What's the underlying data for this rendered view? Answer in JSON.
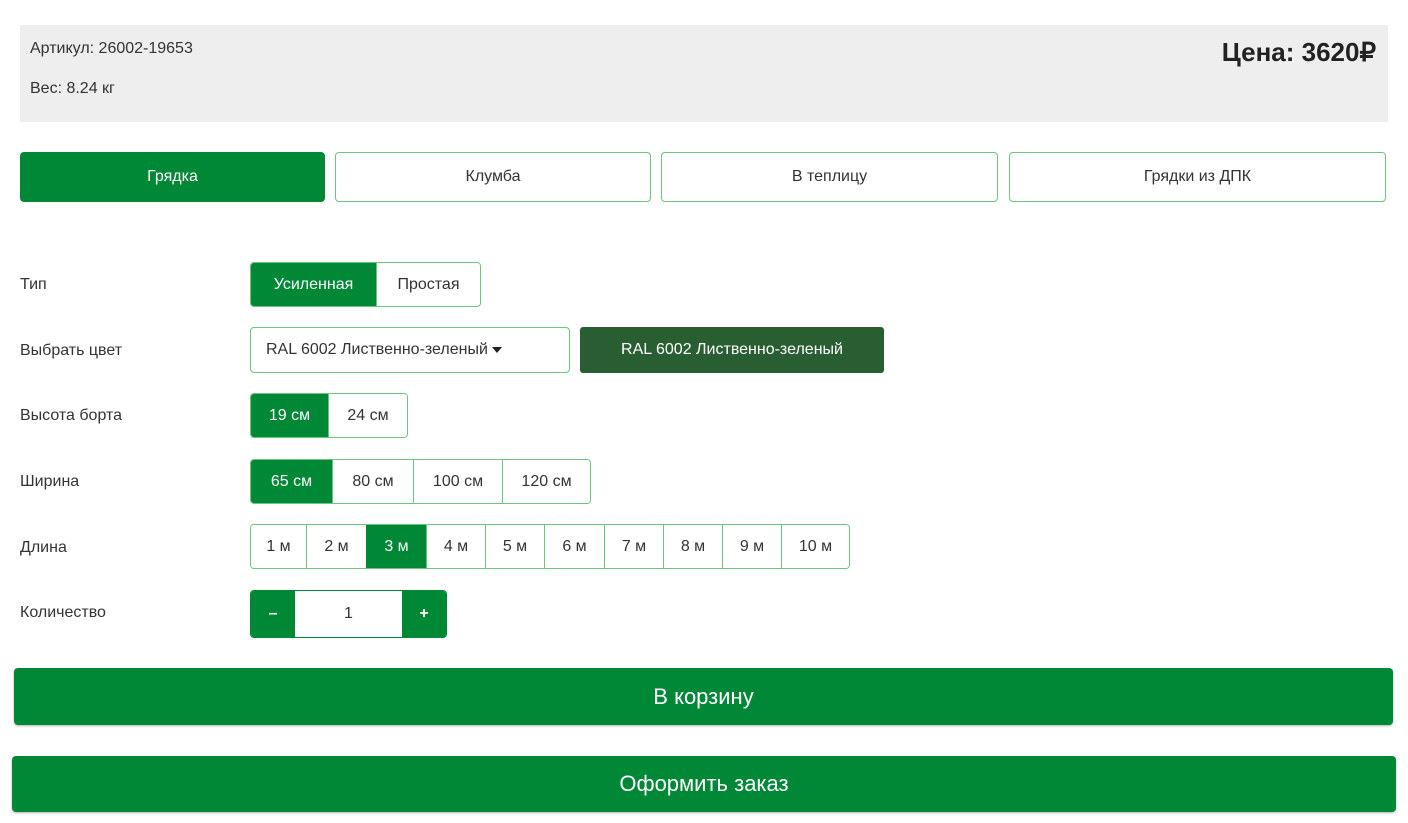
{
  "info": {
    "sku": "Артикул: 26002-19653",
    "weight": "Вес: 8.24 кг",
    "price": "Цена: 3620₽"
  },
  "tabs": [
    {
      "label": "Грядка",
      "active": true
    },
    {
      "label": "Клумба"
    },
    {
      "label": "В теплицу"
    },
    {
      "label": "Грядки из ДПК"
    }
  ],
  "type": {
    "label": "Тип",
    "options": [
      "Усиленная",
      "Простая"
    ],
    "selected": "Усиленная"
  },
  "color": {
    "label": "Выбрать цвет",
    "value": "RAL 6002 Лиственно-зеленый",
    "swatch_label": "RAL 6002 Лиственно-зеленый",
    "swatch_color": "#285e32"
  },
  "height": {
    "label": "Высота борта",
    "options": [
      "19 см",
      "24 см"
    ],
    "selected": "19 см"
  },
  "width": {
    "label": "Ширина",
    "options": [
      "65 см",
      "80 см",
      "100 см",
      "120 см"
    ],
    "selected": "65 см"
  },
  "length": {
    "label": "Длина",
    "options": [
      "1 м",
      "2 м",
      "3 м",
      "4 м",
      "5 м",
      "6 м",
      "7 м",
      "8 м",
      "9 м",
      "10 м"
    ],
    "selected": "3 м"
  },
  "quantity": {
    "label": "Количество",
    "minus": "–",
    "value": "1",
    "plus": "+"
  },
  "actions": {
    "cart": "В корзину",
    "order": "Оформить заказ"
  },
  "colors": {
    "accent": "#008836",
    "border": "#6cc47e",
    "panel": "#eeeeee"
  }
}
